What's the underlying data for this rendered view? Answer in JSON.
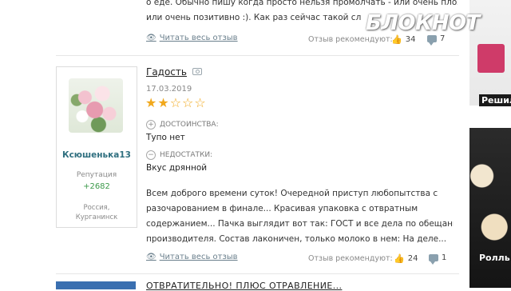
{
  "watermark": {
    "logo_text": "БЛОКНОТ"
  },
  "previous_review": {
    "lines": [
      "о еде. Обычно пишу когда просто нельзя промолчать - или очень плохо,",
      "или очень позитивно :). Как раз сейчас такой сл"
    ],
    "read_more": "Читать весь отзыв",
    "recommend_label": "Отзыв рекомендуют:",
    "likes": "34",
    "comments": "7"
  },
  "review": {
    "title": "Гадость",
    "date": "17.03.2019",
    "rating": 2,
    "rating_max": 5,
    "pros_label": "ДОСТОИНСТВА:",
    "pros_text": "Тупо нет",
    "cons_label": "НЕДОСТАТКИ:",
    "cons_text": "Вкус дрянной",
    "body_lines": [
      "Всем доброго времени суток! Очередной приступ любопытства с",
      "разочарованием в финале... Красивая упаковка с отвратным",
      "содержанием... Пачка выглядит вот так: ГОСТ и все дела по обещаниям",
      "производителя. Состав лаконичен, только молоко в нем: На деле..."
    ],
    "read_more": "Читать весь отзыв",
    "recommend_label": "Отзыв рекомендуют:",
    "likes": "24",
    "comments": "1"
  },
  "user": {
    "name": "Ксюшенька13",
    "reputation_label": "Репутация",
    "reputation_value": "+2682",
    "location_line1": "Россия,",
    "location_line2": "Курганинск"
  },
  "next_review": {
    "title_fragment": "ОТВРАТИТЕЛЬНО! ПЛЮС ОТРАВЛЕНИЕ..."
  },
  "sidebar": {
    "ad1_label": "Решил",
    "ad2_label": "Ролль"
  },
  "colors": {
    "star": "#f1a81c",
    "username": "#2f6f7f",
    "reputation": "#3c9a4a",
    "link": "#6a7f8c"
  }
}
